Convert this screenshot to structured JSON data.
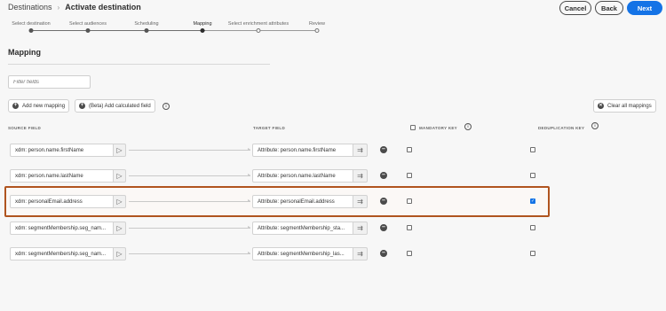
{
  "breadcrumb": {
    "parent": "Destinations",
    "separator": "›",
    "current": "Activate destination"
  },
  "header_buttons": {
    "cancel": "Cancel",
    "back": "Back",
    "next": "Next"
  },
  "steps": [
    {
      "label": "Select destination",
      "state": "done"
    },
    {
      "label": "Select audiences",
      "state": "done"
    },
    {
      "label": "Scheduling",
      "state": "done"
    },
    {
      "label": "Mapping",
      "state": "current"
    },
    {
      "label": "Select enrichment attributes",
      "state": "todo"
    },
    {
      "label": "Review",
      "state": "todo"
    }
  ],
  "page": {
    "title": "Mapping"
  },
  "filter": {
    "placeholder": "Filter fields"
  },
  "toolbar": {
    "add_mapping": "Add new mapping",
    "add_calculated": "(Beta) Add calculated field",
    "clear_all": "Clear all mappings"
  },
  "columns": {
    "source": "SOURCE FIELD",
    "target": "TARGET FIELD",
    "mandatory": "MANDATORY KEY",
    "dedup": "DEDUPLICATION KEY"
  },
  "mappings": [
    {
      "source": "xdm: person.name.firstName",
      "target": "Attribute: person.name.firstName",
      "mandatory": false,
      "dedup": false
    },
    {
      "source": "xdm: person.name.lastName",
      "target": "Attribute: person.name.lastName",
      "mandatory": false,
      "dedup": false
    },
    {
      "source": "xdm: personalEmail.address",
      "target": "Attribute: personalEmail.address",
      "mandatory": false,
      "dedup": true
    },
    {
      "source": "xdm: segmentMembership.seg_nam...",
      "target": "Attribute: segmentMembership_sta...",
      "mandatory": false,
      "dedup": false
    },
    {
      "source": "xdm: segmentMembership.seg_nam...",
      "target": "Attribute: segmentMembership_las...",
      "mandatory": false,
      "dedup": false
    }
  ],
  "colors": {
    "accent": "#1473e6",
    "highlight_border": "#b0541f"
  },
  "icons": {
    "source_picker": "cursor-arrow-icon",
    "target_picker": "mapping-tree-icon",
    "remove": "minus-circle-icon",
    "info": "info-icon",
    "add": "plus-circle-icon"
  }
}
